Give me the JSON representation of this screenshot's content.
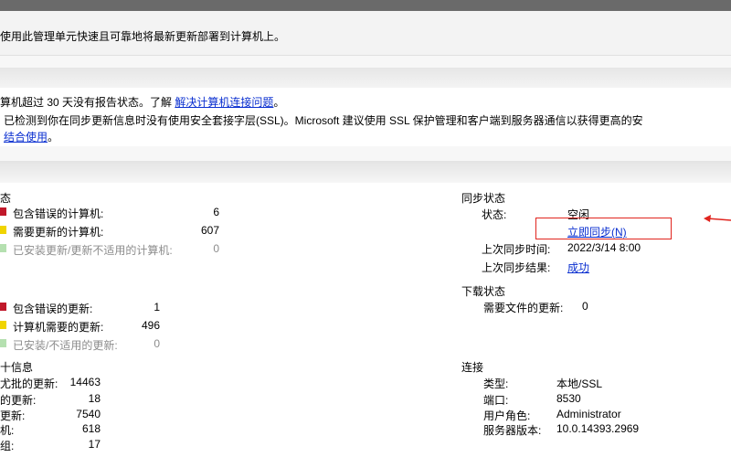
{
  "header": {
    "description": "使用此管理单元快速且可靠地将最新更新部署到计算机上。"
  },
  "alerts": {
    "line1_prefix": "算机超过 30 天没有报告状态。了解",
    "line1_link": "解决计算机连接问题",
    "line1_suffix": "。",
    "line2": "已检测到你在同步更新信息时没有使用安全套接字层(SSL)。Microsoft 建议使用 SSL 保护管理和客户端到服务器通信以获得更高的安",
    "line3_link": "结合使用",
    "line3_suffix": "。"
  },
  "computer_status": {
    "title": "态",
    "rows": [
      {
        "label": "包含错误的计算机:",
        "value": "6",
        "color": "#c0182a",
        "muted": false
      },
      {
        "label": "需要更新的计算机:",
        "value": "607",
        "color": "#f0d400",
        "muted": false
      },
      {
        "label": "已安装更新/更新不适用的计算机:",
        "value": "0",
        "color": "#b5e0b0",
        "muted": true
      }
    ]
  },
  "update_status": {
    "rows": [
      {
        "label": "包含错误的更新:",
        "value": "1",
        "color": "#c0182a",
        "muted": false
      },
      {
        "label": "计算机需要的更新:",
        "value": "496",
        "color": "#f0d400",
        "muted": false
      },
      {
        "label": "已安装/不适用的更新:",
        "value": "0",
        "color": "#b5e0b0",
        "muted": true
      }
    ]
  },
  "stats": {
    "title": "十信息",
    "rows": [
      {
        "label": "尤批的更新:",
        "value": "14463"
      },
      {
        "label": "的更新:",
        "value": "18"
      },
      {
        "label": "更新:",
        "value": "7540"
      },
      {
        "label": "机:",
        "value": "618"
      },
      {
        "label": "组:",
        "value": "17"
      }
    ]
  },
  "sync": {
    "title": "同步状态",
    "status_label": "状态:",
    "status_value": "空闲",
    "sync_now_link": "立即同步(N)",
    "last_sync_time_label": "上次同步时间:",
    "last_sync_time_value": "2022/3/14 8:00",
    "last_sync_result_label": "上次同步结果:",
    "last_sync_result_value": "成功"
  },
  "download": {
    "title": "下载状态",
    "needed_label": "需要文件的更新:",
    "needed_value": "0"
  },
  "connection": {
    "title": "连接",
    "rows": [
      {
        "label": "类型:",
        "value": "本地/SSL"
      },
      {
        "label": "端口:",
        "value": "8530"
      },
      {
        "label": "用户角色:",
        "value": "Administrator"
      },
      {
        "label": "服务器版本:",
        "value": "10.0.14393.2969"
      }
    ]
  },
  "colors": {
    "link": "#0a2fd0",
    "annotation_red": "#e0241e",
    "error": "#c0182a",
    "warning": "#f0d400",
    "ok": "#b5e0b0"
  }
}
